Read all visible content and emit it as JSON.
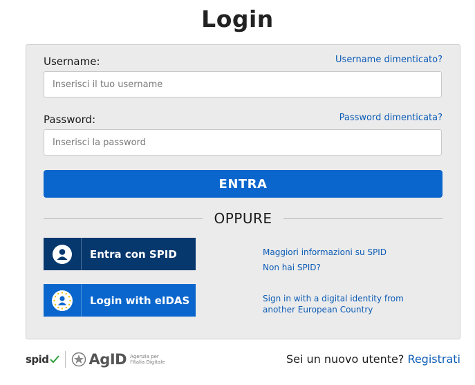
{
  "page": {
    "title": "Login"
  },
  "form": {
    "username": {
      "label": "Username:",
      "placeholder": "Inserisci il tuo username",
      "forgot_link": "Username dimenticato?"
    },
    "password": {
      "label": "Password:",
      "placeholder": "Inserisci la password",
      "forgot_link": "Password dimenticata?"
    },
    "submit_label": "ENTRA",
    "divider_text": "OPPURE"
  },
  "spid": {
    "button_label": "Entra con SPID",
    "icon": "user-icon",
    "links": [
      "Maggiori informazioni su SPID",
      "Non hai SPID?"
    ]
  },
  "eidas": {
    "button_label": "Login with eIDAS",
    "icon": "eu-stars-user-icon",
    "info_link": "Sign in with a digital identity from another European Country"
  },
  "footer": {
    "spid_logo_text": "spid",
    "agid_logo_text": "AgID",
    "agid_subtitle": "Agenzia per l'Italia Digitale",
    "new_user_text": "Sei un nuovo utente?",
    "register_link": "Registrati"
  },
  "colors": {
    "primary": "#0a66cc",
    "spid_dark": "#06386e",
    "link": "#0b5bb5",
    "panel_bg": "#ebebeb"
  }
}
